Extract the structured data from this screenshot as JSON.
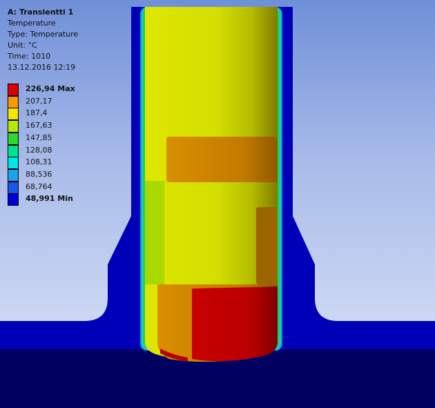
{
  "result": {
    "title": "A: Transientti 1",
    "name": "Temperature",
    "type_line": "Type: Temperature",
    "unit_line": "Unit: °C",
    "time_line": "Time: 1010",
    "date_line": "13.12.2016 12:19"
  },
  "legend": {
    "entries": [
      {
        "label": "226,94 Max",
        "value": 226.94,
        "color": "#dd0000",
        "bold": true
      },
      {
        "label": "207,17",
        "value": 207.17,
        "color": "#f59a00",
        "bold": false
      },
      {
        "label": "187,4",
        "value": 187.4,
        "color": "#f7e600",
        "bold": false
      },
      {
        "label": "167,63",
        "value": 167.63,
        "color": "#b3ea00",
        "bold": false
      },
      {
        "label": "147,85",
        "value": 147.85,
        "color": "#2ed82e",
        "bold": false
      },
      {
        "label": "128,08",
        "value": 128.08,
        "color": "#00e28f",
        "bold": false
      },
      {
        "label": "108,31",
        "value": 108.31,
        "color": "#00e5e5",
        "bold": false
      },
      {
        "label": "88,536",
        "value": 88.536,
        "color": "#1aa3f0",
        "bold": false
      },
      {
        "label": "68,764",
        "value": 68.764,
        "color": "#1a55ee",
        "bold": false
      },
      {
        "label": "48,991 Min",
        "value": 48.991,
        "color": "#0000d8",
        "bold": true
      }
    ]
  },
  "colors": {
    "background_top": "#6f8fd8",
    "background_bottom": "#dfe6f7",
    "housing": "#0000b8",
    "base_plate": "#000060",
    "body_yellow": "#cad600",
    "hot_red": "#c80000"
  }
}
